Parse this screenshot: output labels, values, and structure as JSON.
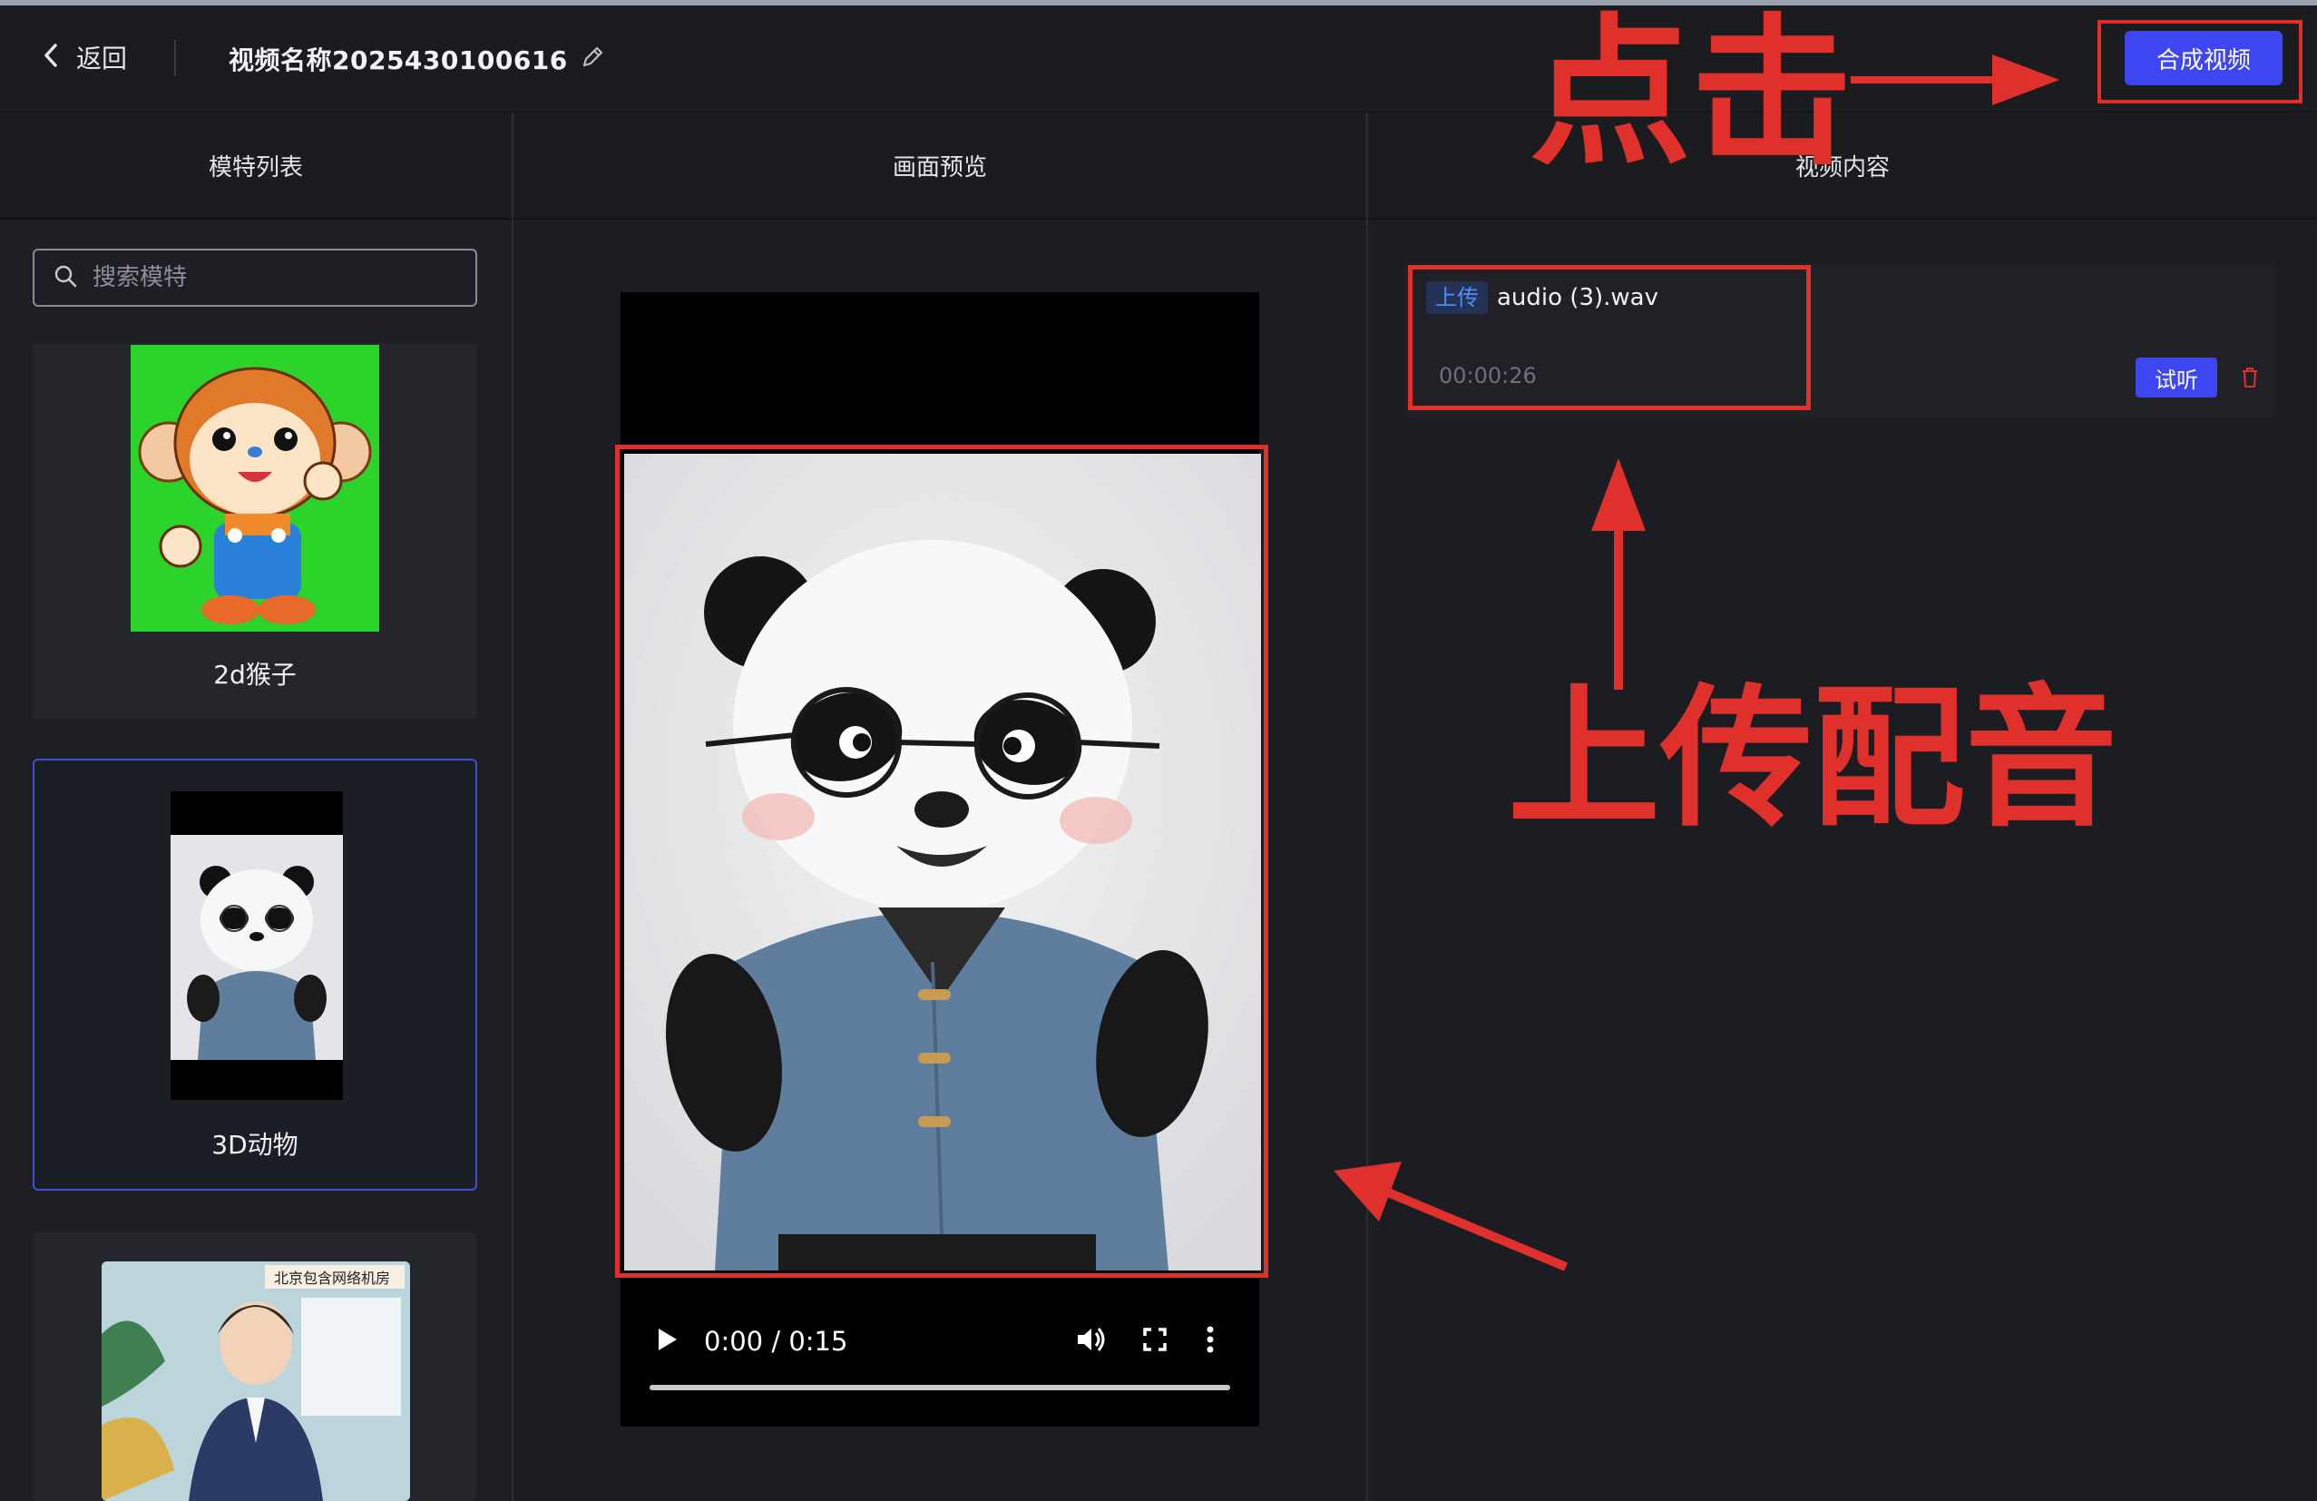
{
  "header": {
    "back_label": "返回",
    "video_title": "视频名称2025430100616",
    "compose_label": "合成视频"
  },
  "columns": {
    "models": "模特列表",
    "preview": "画面预览",
    "content": "视频内容"
  },
  "search": {
    "placeholder": "搜索模特"
  },
  "models": [
    {
      "label": "2d猴子",
      "selected": false
    },
    {
      "label": "3D动物",
      "selected": true
    },
    {
      "label": "",
      "selected": false,
      "image_text": "北京包含网络机房"
    }
  ],
  "player": {
    "time": "0:00 / 0:15",
    "progress": 1.0
  },
  "audio": {
    "tag": "上传",
    "filename": "audio (3).wav",
    "duration": "00:00:26",
    "listen_label": "试听"
  },
  "annotations": {
    "click": "点击",
    "upload_voice": "上传配音"
  },
  "colors": {
    "accent": "#3d46f0",
    "annotation_red": "#e0302c",
    "background": "#1c1d21"
  },
  "icons": [
    "chevron-left-icon",
    "edit-pencil-icon",
    "search-icon",
    "play-icon",
    "volume-icon",
    "fullscreen-icon",
    "more-vertical-icon",
    "trash-icon"
  ]
}
